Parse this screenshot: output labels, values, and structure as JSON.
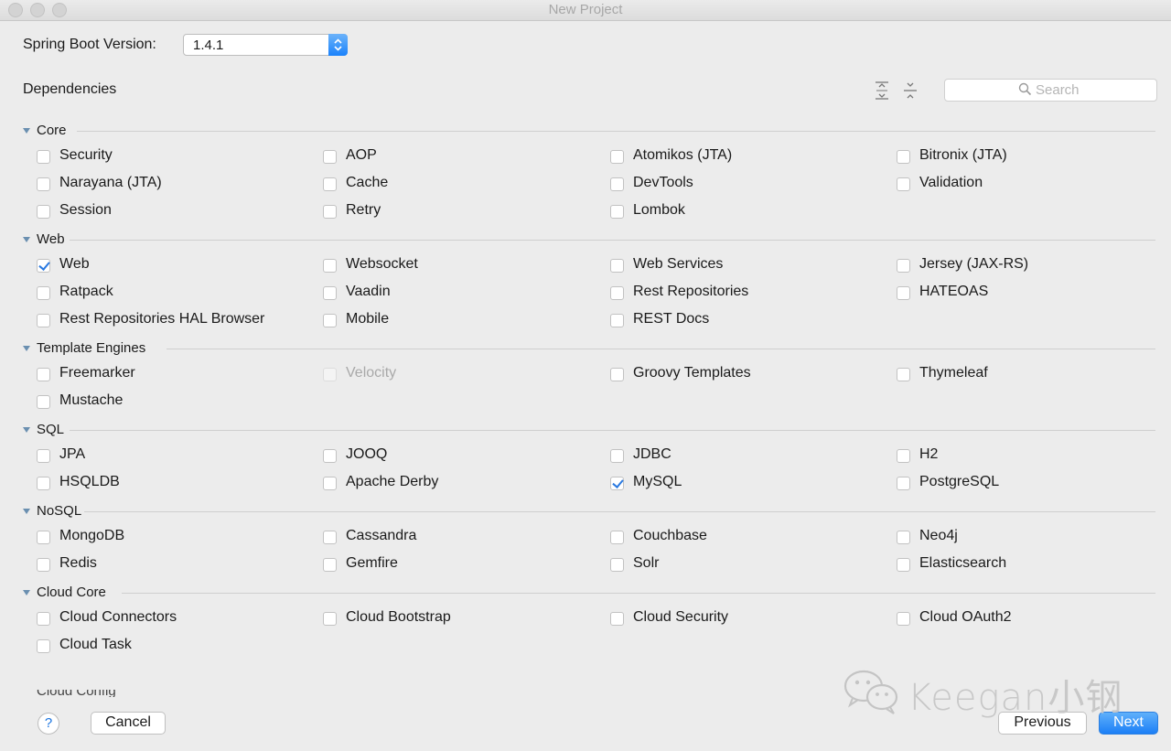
{
  "window": {
    "title": "New Project"
  },
  "version": {
    "label": "Spring Boot Version:",
    "value": "1.4.1"
  },
  "dependencies": {
    "label": "Dependencies"
  },
  "search": {
    "placeholder": "Search"
  },
  "sections": [
    {
      "name": "Core",
      "items": [
        {
          "label": "Security",
          "checked": false
        },
        {
          "label": "AOP",
          "checked": false
        },
        {
          "label": "Atomikos (JTA)",
          "checked": false
        },
        {
          "label": "Bitronix (JTA)",
          "checked": false
        },
        {
          "label": "Narayana (JTA)",
          "checked": false
        },
        {
          "label": "Cache",
          "checked": false
        },
        {
          "label": "DevTools",
          "checked": false
        },
        {
          "label": "Validation",
          "checked": false
        },
        {
          "label": "Session",
          "checked": false
        },
        {
          "label": "Retry",
          "checked": false
        },
        {
          "label": "Lombok",
          "checked": false
        }
      ]
    },
    {
      "name": "Web",
      "items": [
        {
          "label": "Web",
          "checked": true
        },
        {
          "label": "Websocket",
          "checked": false
        },
        {
          "label": "Web Services",
          "checked": false
        },
        {
          "label": "Jersey (JAX-RS)",
          "checked": false
        },
        {
          "label": "Ratpack",
          "checked": false
        },
        {
          "label": "Vaadin",
          "checked": false
        },
        {
          "label": "Rest Repositories",
          "checked": false
        },
        {
          "label": "HATEOAS",
          "checked": false
        },
        {
          "label": "Rest Repositories HAL Browser",
          "checked": false
        },
        {
          "label": "Mobile",
          "checked": false
        },
        {
          "label": "REST Docs",
          "checked": false
        }
      ]
    },
    {
      "name": "Template Engines",
      "items": [
        {
          "label": "Freemarker",
          "checked": false
        },
        {
          "label": "Velocity",
          "checked": false,
          "disabled": true
        },
        {
          "label": "Groovy Templates",
          "checked": false
        },
        {
          "label": "Thymeleaf",
          "checked": false
        },
        {
          "label": "Mustache",
          "checked": false
        }
      ]
    },
    {
      "name": "SQL",
      "items": [
        {
          "label": "JPA",
          "checked": false
        },
        {
          "label": "JOOQ",
          "checked": false
        },
        {
          "label": "JDBC",
          "checked": false
        },
        {
          "label": "H2",
          "checked": false
        },
        {
          "label": "HSQLDB",
          "checked": false
        },
        {
          "label": "Apache Derby",
          "checked": false
        },
        {
          "label": "MySQL",
          "checked": true
        },
        {
          "label": "PostgreSQL",
          "checked": false
        }
      ]
    },
    {
      "name": "NoSQL",
      "items": [
        {
          "label": "MongoDB",
          "checked": false
        },
        {
          "label": "Cassandra",
          "checked": false
        },
        {
          "label": "Couchbase",
          "checked": false
        },
        {
          "label": "Neo4j",
          "checked": false
        },
        {
          "label": "Redis",
          "checked": false
        },
        {
          "label": "Gemfire",
          "checked": false
        },
        {
          "label": "Solr",
          "checked": false
        },
        {
          "label": "Elasticsearch",
          "checked": false
        }
      ]
    },
    {
      "name": "Cloud Core",
      "items": [
        {
          "label": "Cloud Connectors",
          "checked": false
        },
        {
          "label": "Cloud Bootstrap",
          "checked": false
        },
        {
          "label": "Cloud Security",
          "checked": false
        },
        {
          "label": "Cloud OAuth2",
          "checked": false
        },
        {
          "label": "Cloud Task",
          "checked": false
        }
      ]
    }
  ],
  "partial_section": "Cloud Config",
  "buttons": {
    "help": "?",
    "cancel": "Cancel",
    "previous": "Previous",
    "next": "Next"
  },
  "watermark": {
    "text": "Keegan小钢"
  },
  "colors": {
    "accent": "#1c7ff6",
    "check": "#2a79e0",
    "disabled_text": "#a9a9a9"
  }
}
